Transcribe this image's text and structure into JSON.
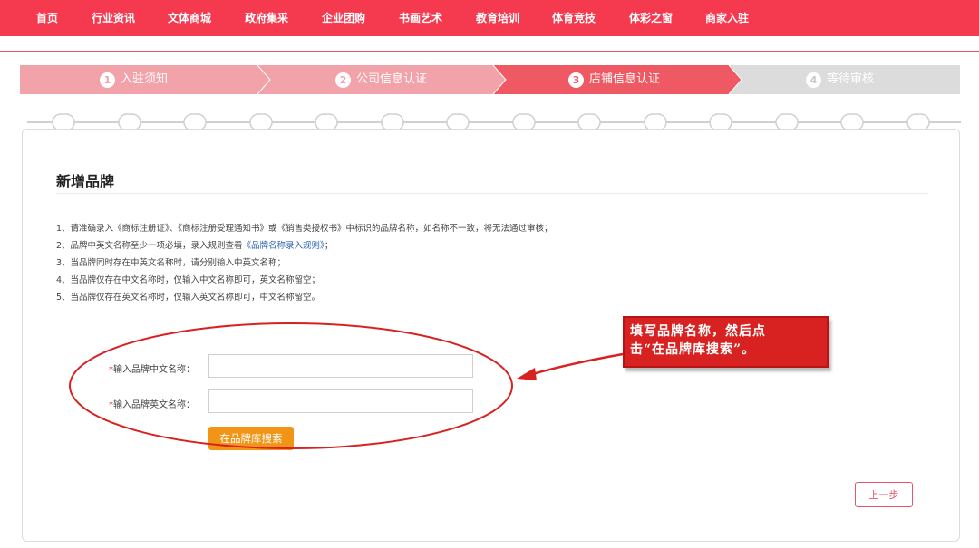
{
  "nav": {
    "items": [
      "首页",
      "行业资讯",
      "文体商城",
      "政府集采",
      "企业团购",
      "书画艺术",
      "教育培训",
      "体育竞技",
      "体彩之窗",
      "商家入驻"
    ]
  },
  "steps": [
    {
      "num": "1",
      "label": "入驻须知"
    },
    {
      "num": "2",
      "label": "公司信息认证"
    },
    {
      "num": "3",
      "label": "店铺信息认证"
    },
    {
      "num": "4",
      "label": "等待审核"
    }
  ],
  "colors": {
    "nav_bg": "#f5394f",
    "step_done": "#f2a2a9",
    "step_active": "#ef5963",
    "step_pending": "#dcdcdc",
    "search_button": "#f29516",
    "annotation": "#d82222"
  },
  "form": {
    "title": "新增品牌",
    "rules": [
      "1、请准确录入《商标注册证》、《商标注册受理通知书》或《销售类授权书》中标识的品牌名称，如名称不一致，将无法通过审核；",
      {
        "before": "2、品牌中英文名称至少一项必填，录入规则查看",
        "link": "《品牌名称录入规则》",
        "after": "；"
      },
      "3、当品牌同时存在中英文名称时，请分别输入中英文名称；",
      "4、当品牌仅存在中文名称时，仅输入中文名称即可，英文名称留空；",
      "5、当品牌仅存在英文名称时，仅输入英文名称即可，中文名称留空。"
    ],
    "cn_name": {
      "required": "*",
      "label": "输入品牌中文名称：",
      "value": ""
    },
    "en_name": {
      "required": "*",
      "label": "输入品牌英文名称：",
      "value": ""
    },
    "search_label": "在品牌库搜索",
    "prev_label": "上一步"
  },
  "annotation": {
    "line1": "填写品牌名称，然后点",
    "line2": "击“在品牌库搜索”。"
  }
}
